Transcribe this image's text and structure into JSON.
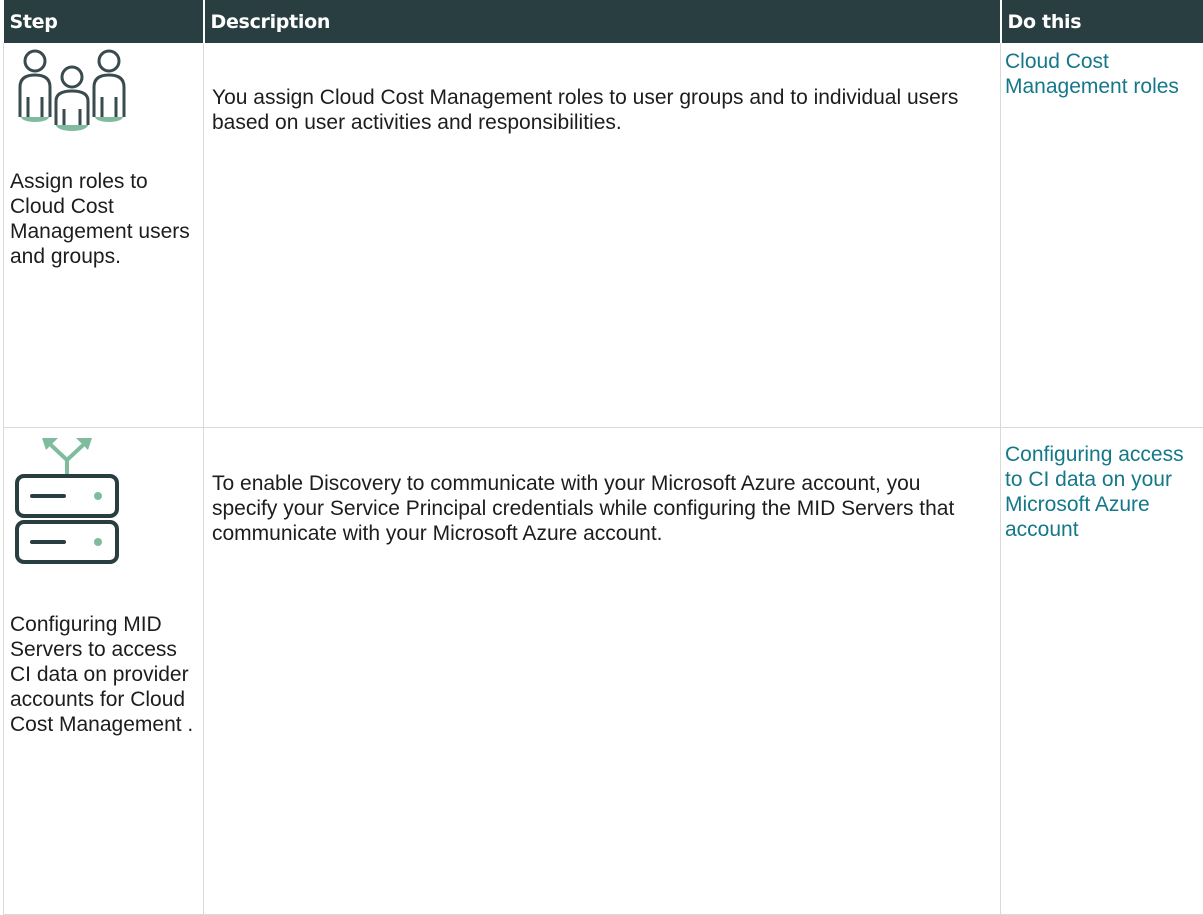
{
  "table": {
    "headers": {
      "step": "Step",
      "description": "Description",
      "do_this": "Do this"
    },
    "rows": [
      {
        "icon": "user-group-icon",
        "step": "Assign roles to Cloud Cost Management users and groups.",
        "description": "You assign Cloud Cost Management roles to user groups and to individual users based on user activities and responsibilities.",
        "link": "Cloud Cost Management roles"
      },
      {
        "icon": "server-network-icon",
        "step": "Configuring MID Servers to access CI data on provider accounts for Cloud Cost Management .",
        "description": "To enable Discovery to communicate with your Microsoft Azure account, you specify your Service Principal credentials while configuring the MID Servers that communicate with your Microsoft Azure account.",
        "link": "Configuring access to CI data on your Microsoft Azure account"
      }
    ]
  },
  "colors": {
    "header_bg": "#293e40",
    "header_text": "#ffffff",
    "link": "#14788a",
    "icon_dark": "#293e40",
    "icon_green": "#7fbc9e"
  }
}
